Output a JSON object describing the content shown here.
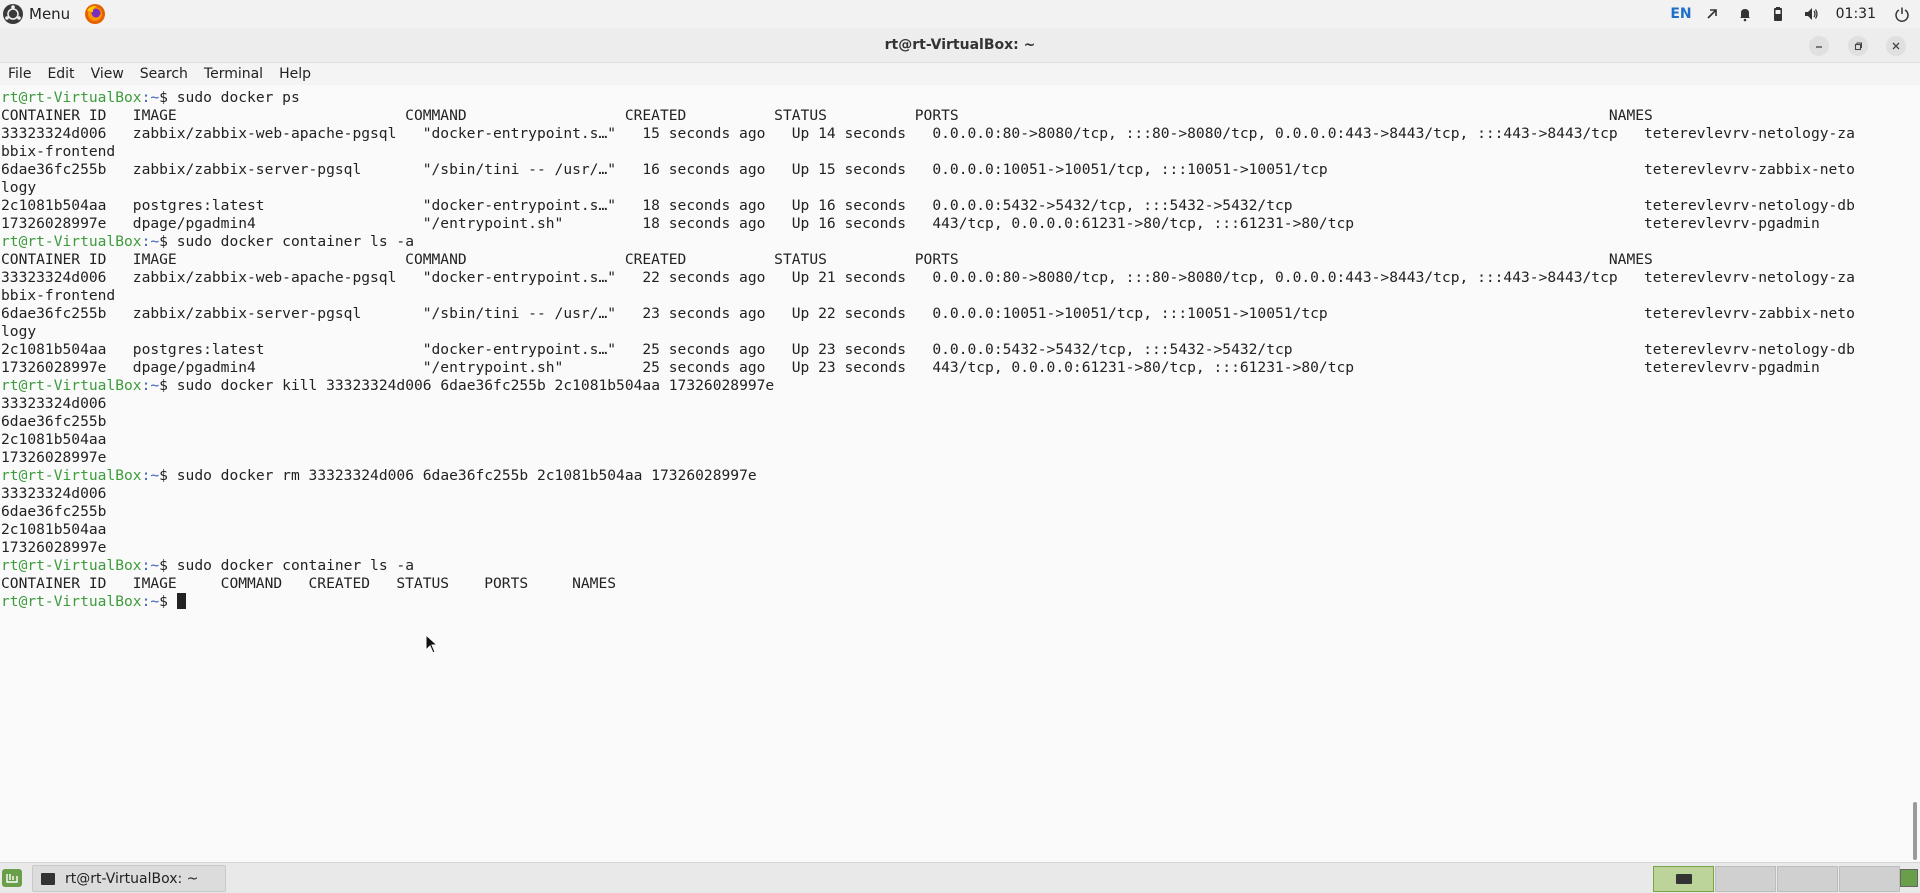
{
  "panel": {
    "menu_label": "Menu",
    "language": "EN",
    "clock": "01:31",
    "icons": [
      "mint-logo-icon",
      "firefox-icon",
      "network-icon",
      "bell-icon",
      "battery-icon",
      "volume-icon",
      "power-icon"
    ]
  },
  "window": {
    "title": "rt@rt-VirtualBox: ~",
    "controls": [
      "minimize-icon",
      "maximize-icon",
      "close-icon"
    ]
  },
  "menubar": [
    "File",
    "Edit",
    "View",
    "Search",
    "Terminal",
    "Help"
  ],
  "prompt": {
    "user_host": "rt@rt-VirtualBox",
    "path": ":~",
    "symbol": "$ "
  },
  "terminal_lines": [
    {
      "type": "prompt",
      "cmd": "sudo docker ps"
    },
    {
      "type": "out",
      "text": "CONTAINER ID   IMAGE                          COMMAND                  CREATED          STATUS          PORTS                                                                          NAMES"
    },
    {
      "type": "out",
      "text": "33323324d006   zabbix/zabbix-web-apache-pgsql   \"docker-entrypoint.s…\"   15 seconds ago   Up 14 seconds   0.0.0.0:80->8080/tcp, :::80->8080/tcp, 0.0.0.0:443->8443/tcp, :::443->8443/tcp   teterevlevrv-netology-za"
    },
    {
      "type": "out",
      "text": "bbix-frontend"
    },
    {
      "type": "out",
      "text": "6dae36fc255b   zabbix/zabbix-server-pgsql       \"/sbin/tini -- /usr/…\"   16 seconds ago   Up 15 seconds   0.0.0.0:10051->10051/tcp, :::10051->10051/tcp                                    teterevlevrv-zabbix-neto"
    },
    {
      "type": "out",
      "text": "logy"
    },
    {
      "type": "out",
      "text": "2c1081b504aa   postgres:latest                  \"docker-entrypoint.s…\"   18 seconds ago   Up 16 seconds   0.0.0.0:5432->5432/tcp, :::5432->5432/tcp                                        teterevlevrv-netology-db"
    },
    {
      "type": "out",
      "text": "17326028997e   dpage/pgadmin4                   \"/entrypoint.sh\"         18 seconds ago   Up 16 seconds   443/tcp, 0.0.0.0:61231->80/tcp, :::61231->80/tcp                                 teterevlevrv-pgadmin"
    },
    {
      "type": "prompt",
      "cmd": "sudo docker container ls -a"
    },
    {
      "type": "out",
      "text": "CONTAINER ID   IMAGE                          COMMAND                  CREATED          STATUS          PORTS                                                                          NAMES"
    },
    {
      "type": "out",
      "text": "33323324d006   zabbix/zabbix-web-apache-pgsql   \"docker-entrypoint.s…\"   22 seconds ago   Up 21 seconds   0.0.0.0:80->8080/tcp, :::80->8080/tcp, 0.0.0.0:443->8443/tcp, :::443->8443/tcp   teterevlevrv-netology-za"
    },
    {
      "type": "out",
      "text": "bbix-frontend"
    },
    {
      "type": "out",
      "text": "6dae36fc255b   zabbix/zabbix-server-pgsql       \"/sbin/tini -- /usr/…\"   23 seconds ago   Up 22 seconds   0.0.0.0:10051->10051/tcp, :::10051->10051/tcp                                    teterevlevrv-zabbix-neto"
    },
    {
      "type": "out",
      "text": "logy"
    },
    {
      "type": "out",
      "text": "2c1081b504aa   postgres:latest                  \"docker-entrypoint.s…\"   25 seconds ago   Up 23 seconds   0.0.0.0:5432->5432/tcp, :::5432->5432/tcp                                        teterevlevrv-netology-db"
    },
    {
      "type": "out",
      "text": "17326028997e   dpage/pgadmin4                   \"/entrypoint.sh\"         25 seconds ago   Up 23 seconds   443/tcp, 0.0.0.0:61231->80/tcp, :::61231->80/tcp                                 teterevlevrv-pgadmin"
    },
    {
      "type": "prompt",
      "cmd": "sudo docker kill 33323324d006 6dae36fc255b 2c1081b504aa 17326028997e"
    },
    {
      "type": "out",
      "text": "33323324d006"
    },
    {
      "type": "out",
      "text": "6dae36fc255b"
    },
    {
      "type": "out",
      "text": "2c1081b504aa"
    },
    {
      "type": "out",
      "text": "17326028997e"
    },
    {
      "type": "prompt",
      "cmd": "sudo docker rm 33323324d006 6dae36fc255b 2c1081b504aa 17326028997e"
    },
    {
      "type": "out",
      "text": "33323324d006"
    },
    {
      "type": "out",
      "text": "6dae36fc255b"
    },
    {
      "type": "out",
      "text": "2c1081b504aa"
    },
    {
      "type": "out",
      "text": "17326028997e"
    },
    {
      "type": "prompt",
      "cmd": "sudo docker container ls -a"
    },
    {
      "type": "out",
      "text": "CONTAINER ID   IMAGE     COMMAND   CREATED   STATUS    PORTS     NAMES"
    },
    {
      "type": "prompt",
      "cmd": "",
      "cursor": true
    }
  ],
  "taskbar": {
    "task_label": "rt@rt-VirtualBox: ~",
    "workspaces": 4
  },
  "colors": {
    "prompt_user": "#3d9c3c",
    "prompt_path": "#3d60b8",
    "lang": "#1e6fc7"
  }
}
